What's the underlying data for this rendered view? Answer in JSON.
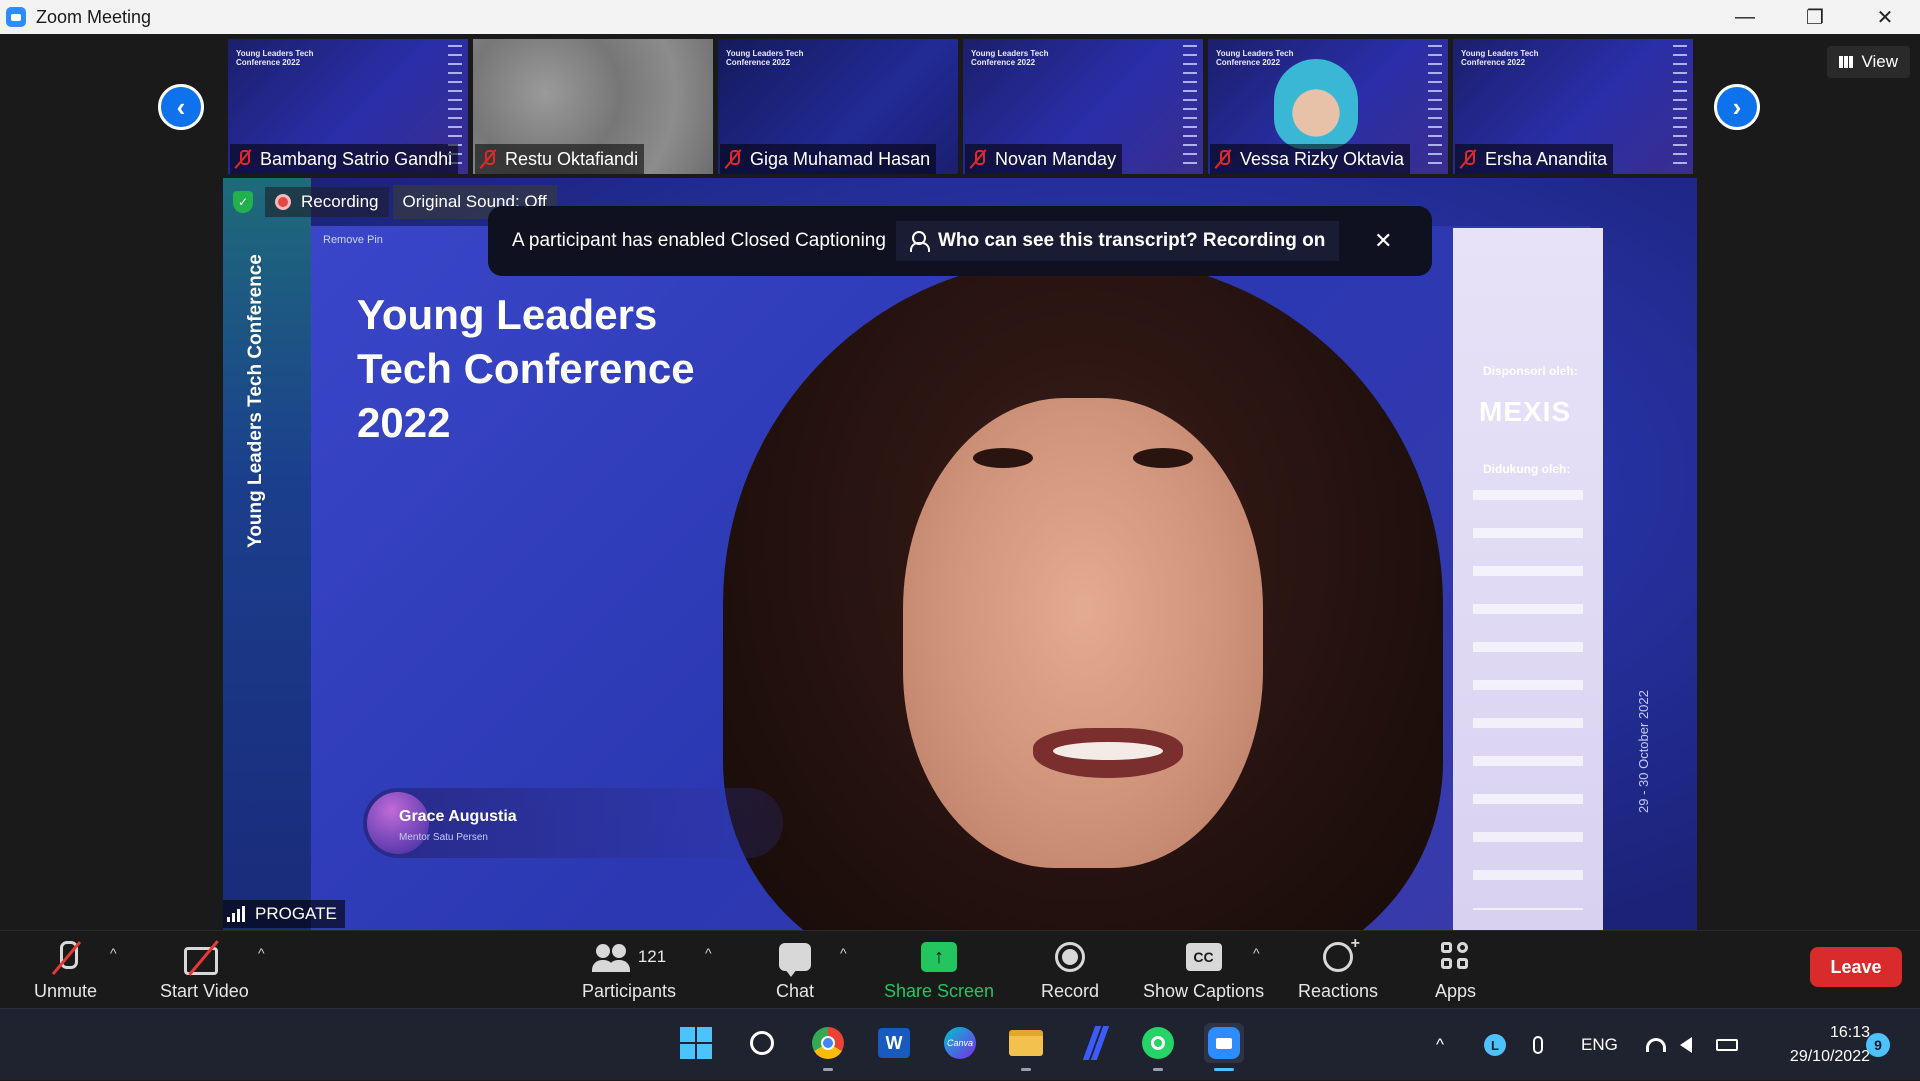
{
  "window": {
    "title": "Zoom Meeting",
    "minimize_glyph": "—",
    "maximize_glyph": "❐",
    "close_glyph": "✕"
  },
  "gallery": {
    "view_label": "View",
    "prev_glyph": "‹",
    "next_glyph": "›",
    "thumbnail_title_line": "Young Leaders Tech Conference 2022",
    "participants": [
      {
        "name": "Bambang Satrio Gandhi",
        "muted": true
      },
      {
        "name": "Restu Oktafiandi",
        "muted": true
      },
      {
        "name": "Giga Muhamad Hasan",
        "muted": true
      },
      {
        "name": "Novan Manday",
        "muted": true
      },
      {
        "name": "Vessa Rizky Oktavia",
        "muted": true
      },
      {
        "name": "Ersha Anandita",
        "muted": true
      }
    ]
  },
  "main_video": {
    "recording_label": "Recording",
    "original_sound_label": "Original Sound: Off",
    "vertical_title": "Young Leaders Tech Conference",
    "slide_title_lines": [
      "Young Leaders",
      "Tech Conference",
      "2022"
    ],
    "remove_pin": "Remove Pin",
    "sponsored_label": "Disponsori oleh:",
    "sponsor_logo": "MEXIS",
    "supported_label": "Didukung oleh:",
    "date_text": "29 - 30 October 2022",
    "speaker_name": "Grace Augustia",
    "speaker_role": "Mentor Satu Persen",
    "network_label": "PROGATE"
  },
  "caption_banner": {
    "message": "A participant has enabled Closed Captioning",
    "who_label": "Who can see this transcript? Recording on",
    "close_glyph": "✕"
  },
  "toolbar": {
    "unmute": "Unmute",
    "start_video": "Start Video",
    "participants": "Participants",
    "participants_count": "121",
    "chat": "Chat",
    "share_screen": "Share Screen",
    "record": "Record",
    "show_captions": "Show Captions",
    "cc_glyph": "CC",
    "reactions": "Reactions",
    "apps": "Apps",
    "leave": "Leave",
    "caret_glyph": "^"
  },
  "taskbar": {
    "apps": [
      "windows-start-icon",
      "search-icon",
      "chrome-icon",
      "word-icon",
      "canva-icon",
      "file-explorer-icon",
      "pen-app-icon",
      "whatsapp-icon",
      "zoom-icon"
    ],
    "canva_text": "Canva",
    "word_text": "W",
    "tray_chevron": "^",
    "language": "ENG",
    "user_initial": "L",
    "time": "16:13",
    "date": "29/10/2022",
    "notification_count": "9"
  },
  "colors": {
    "accent_blue": "#0e72ed",
    "leave_red": "#d92b2b",
    "share_green": "#23c55e",
    "muted_red": "#e02828"
  }
}
